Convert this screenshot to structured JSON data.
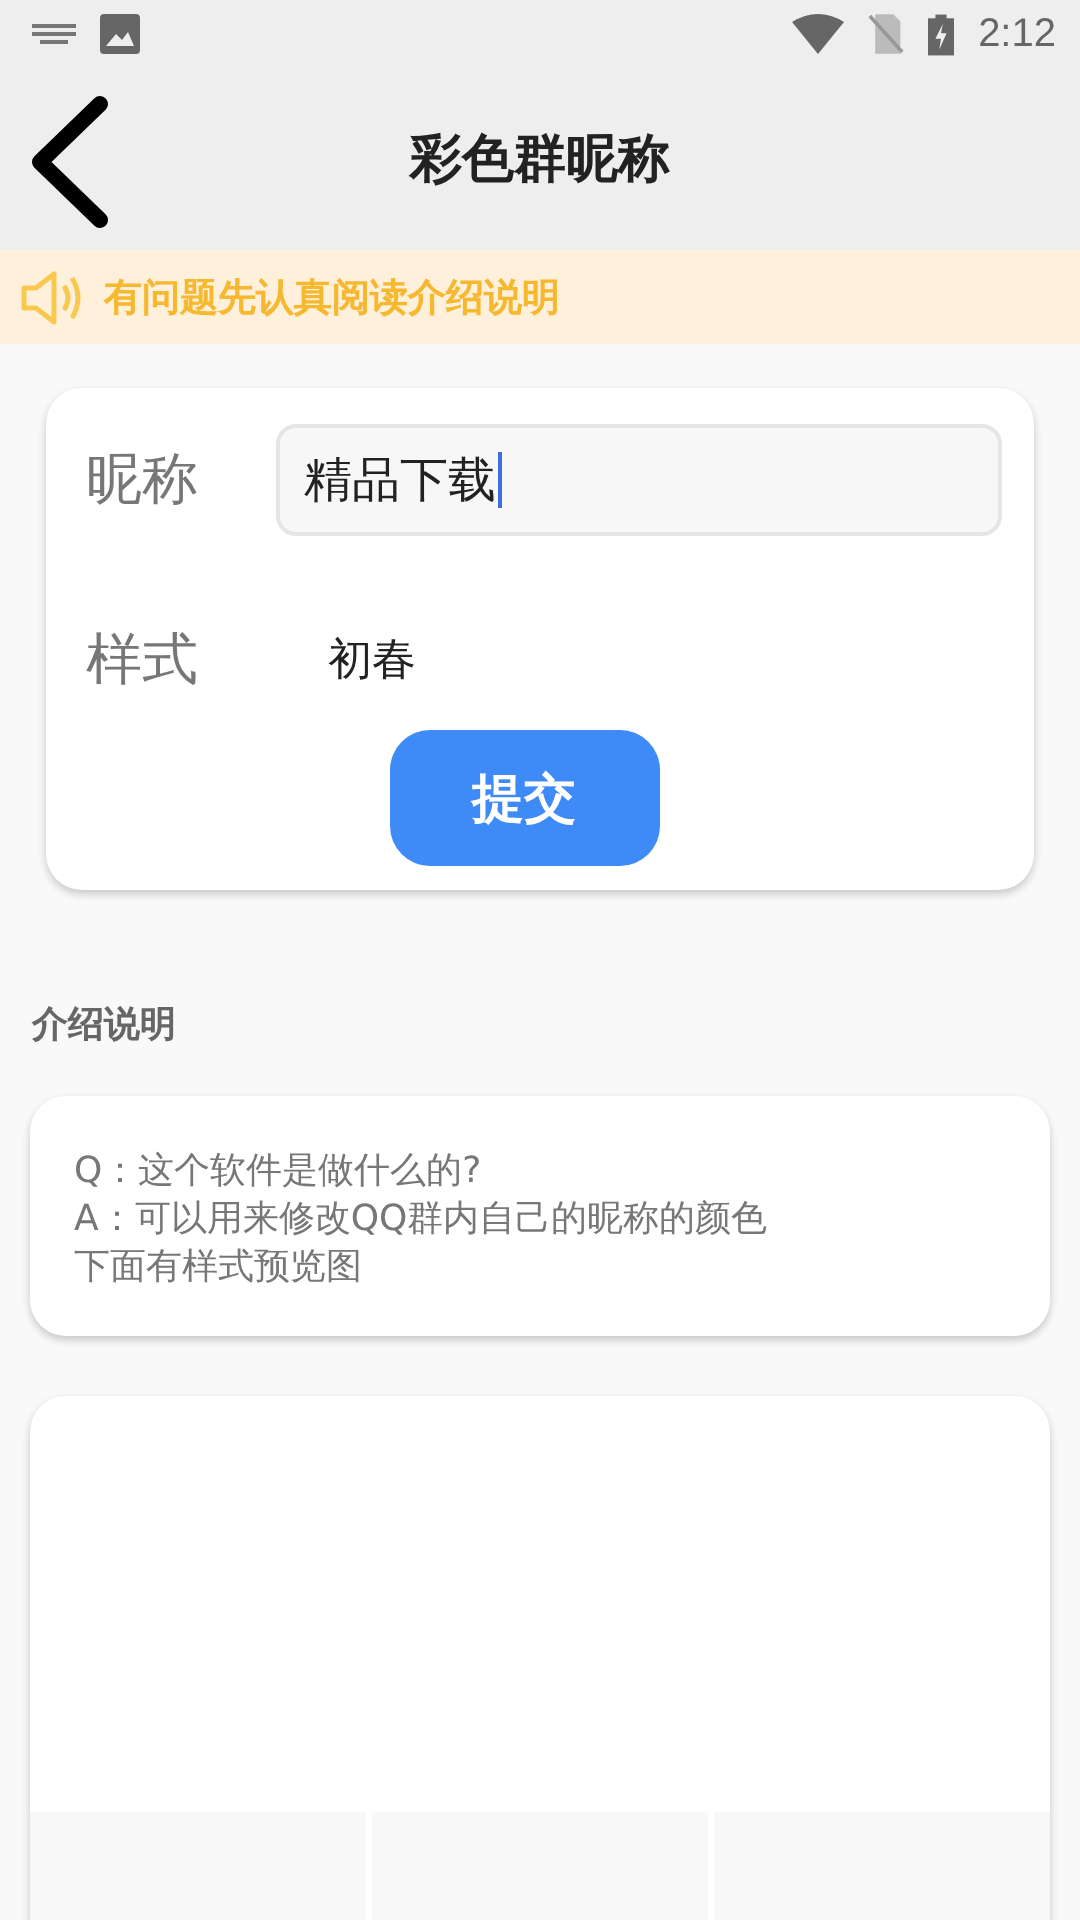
{
  "status_bar": {
    "time": "2:12"
  },
  "toolbar": {
    "title": "彩色群昵称"
  },
  "notice": {
    "text": "有问题先认真阅读介绍说明"
  },
  "form": {
    "fields": [
      {
        "kind": "input",
        "label": "昵称",
        "value": "精品下载",
        "focused": true
      },
      {
        "kind": "text",
        "label": "样式",
        "value": "初春"
      }
    ],
    "submit": "提交"
  },
  "intro": {
    "heading": "介绍说明",
    "lines": [
      "Q：这个软件是做什么的?",
      "A：可以用来修改QQ群内自己的昵称的颜色",
      "下面有样式预览图"
    ]
  }
}
